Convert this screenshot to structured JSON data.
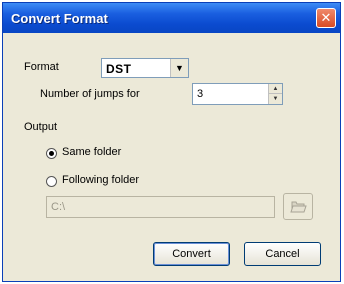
{
  "dialog": {
    "title": "Convert Format",
    "close_glyph": "✕"
  },
  "format": {
    "label": "Format",
    "selected": "DST",
    "dropdown_glyph": "▼"
  },
  "jumps": {
    "label": "Number of jumps for",
    "value": "3",
    "up_glyph": "▲",
    "down_glyph": "▼"
  },
  "output": {
    "group_label": "Output",
    "same_folder_label": "Same folder",
    "same_folder_selected": true,
    "following_folder_label": "Following folder",
    "following_folder_selected": false,
    "path_value": "C:\\"
  },
  "buttons": {
    "convert_label": "Convert",
    "cancel_label": "Cancel"
  },
  "icons": {
    "close": "close-icon",
    "browse": "folder-open-icon"
  }
}
